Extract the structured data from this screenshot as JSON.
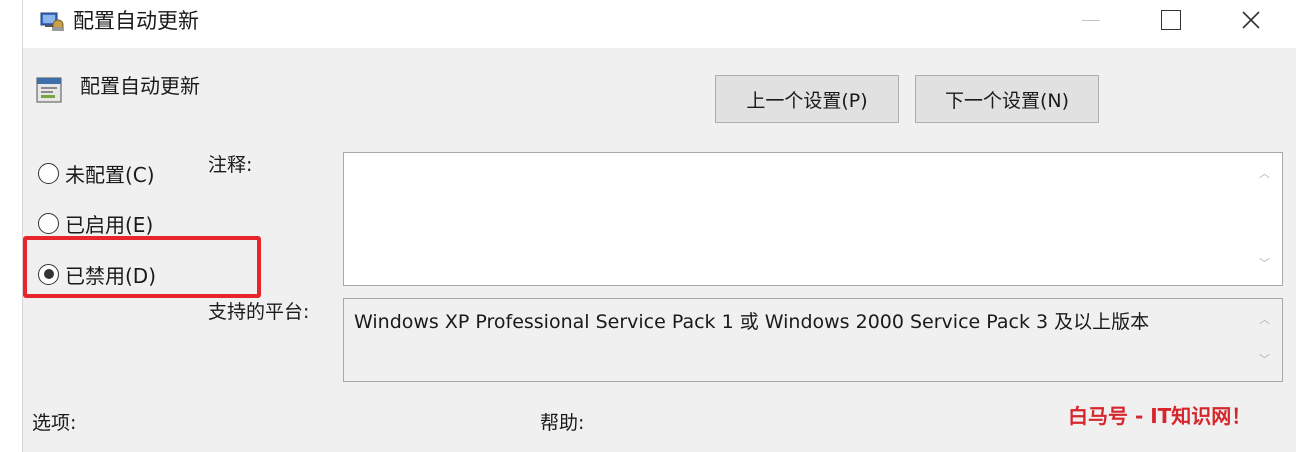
{
  "window": {
    "title": "配置自动更新",
    "icon": "group-policy-icon"
  },
  "header": {
    "title": "配置自动更新",
    "icon": "policy-setting-icon",
    "prev_button": "上一个设置(P)",
    "next_button": "下一个设置(N)"
  },
  "options": [
    {
      "label": "未配置(C)",
      "selected": false
    },
    {
      "label": "已启用(E)",
      "selected": false
    },
    {
      "label": "已禁用(D)",
      "selected": true
    }
  ],
  "comment": {
    "label": "注释:",
    "value": ""
  },
  "platform": {
    "label": "支持的平台:",
    "value": "Windows XP Professional Service Pack 1 或 Windows 2000 Service Pack 3 及以上版本"
  },
  "footer": {
    "options_label": "选项:",
    "help_label": "帮助:"
  },
  "watermark": "白马号 - IT知识网！",
  "colors": {
    "highlight": "#e8252a",
    "watermark": "#d6262b",
    "background": "#f0f0f0"
  }
}
